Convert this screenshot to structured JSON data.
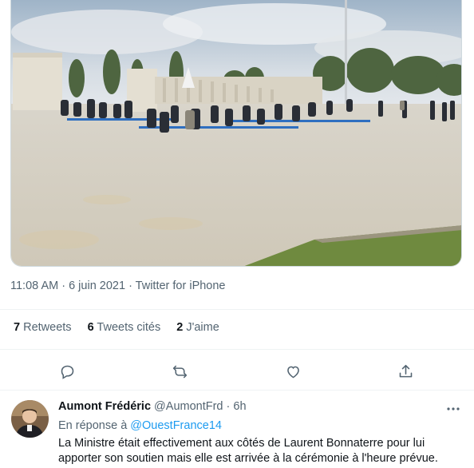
{
  "tweet": {
    "time": "11:08 AM",
    "separator": " · ",
    "date": "6 juin 2021",
    "source": "Twitter for iPhone"
  },
  "stats": {
    "retweets_count": "7",
    "retweets_label": "Retweets",
    "quotes_count": "6",
    "quotes_label": "Tweets cités",
    "likes_count": "2",
    "likes_label": "J'aime"
  },
  "actions": {
    "icons": [
      "reply-icon",
      "retweet-icon",
      "like-icon",
      "share-icon"
    ]
  },
  "reply": {
    "name": "Aumont Frédéric",
    "handle": "@AumontFrd",
    "dot": " · ",
    "time": "6h",
    "in_reply_prefix": "En réponse à ",
    "in_reply_to": "@OuestFrance14",
    "text": "La Ministre était effectivement aux côtés de Laurent Bonnaterre pour lui apporter son soutien mais elle est arrivée à la cérémonie à l'heure prévue."
  },
  "colors": {
    "text_primary": "#0f1419",
    "text_secondary": "#536471",
    "link": "#1d9bf0",
    "divider": "#eff3f4"
  }
}
